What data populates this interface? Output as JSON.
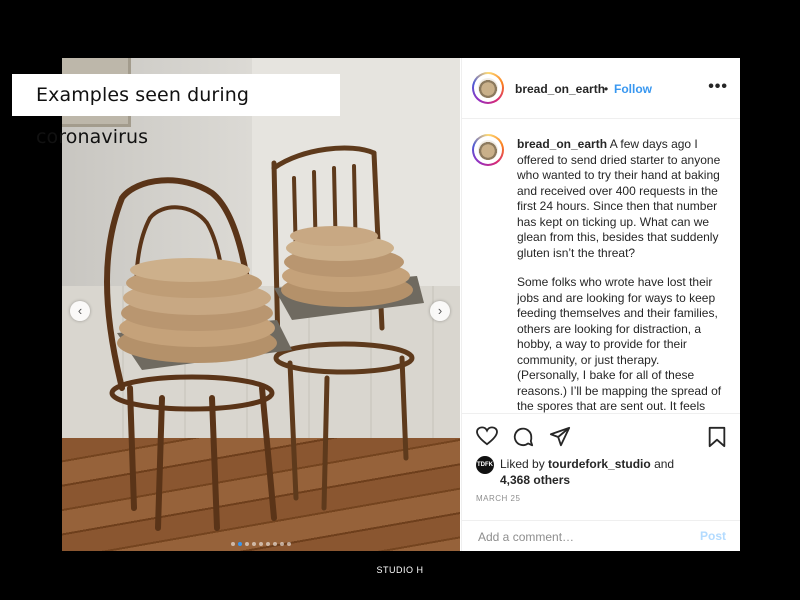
{
  "banner": {
    "text": "Examples seen during coronavirus"
  },
  "post": {
    "username": "bread_on_earth",
    "follow_label": "Follow",
    "separator": "•",
    "more_label": "•••",
    "caption_paragraph_1": "A few days ago I offered to send dried starter to anyone who wanted to try their hand at baking and received over 400 requests in the first 24 hours. Since then that number has kept on ticking up. What can we glean from this, besides that suddenly gluten isn’t the threat?",
    "caption_paragraph_2": "Some folks who wrote have lost their jobs and are looking for ways to keep feeding themselves and their families, others are looking for distraction, a hobby, a way to provide for their community, or just therapy. (Personally, I bake for all of these reasons.) I’ll be mapping the spread of the spores that are sent out. It feels",
    "liked_by_prefix": "Liked by",
    "liked_by_user": "tourdefork_studio",
    "liked_by_and": "and",
    "liked_by_others": "4,368 others",
    "like_avatar_text": "TDFK",
    "date": "MARCH 25",
    "comment_placeholder": "Add a comment…",
    "post_label": "Post"
  },
  "carousel": {
    "prev_arrow": "‹",
    "next_arrow": "›",
    "total_dots": 9,
    "active_dot_index": 1
  },
  "footer": {
    "text": "STUDIO H"
  },
  "colors": {
    "link_blue": "#3897f0",
    "post_disabled": "#b3dbff",
    "active_dot": "#3897f0"
  }
}
